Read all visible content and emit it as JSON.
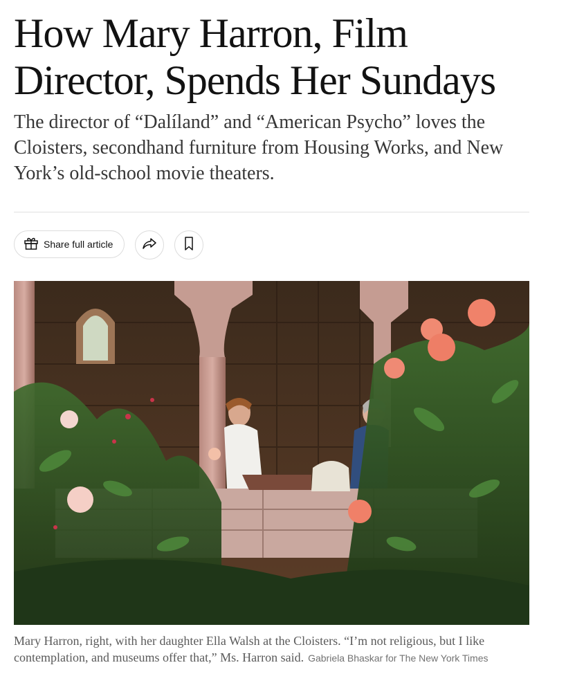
{
  "article": {
    "headline": "How Mary Harron, Film Director, Spends Her Sundays",
    "summary": "The director of “Dalíland” and “American Psycho” loves the Cloisters, secondhand furniture from Housing Works, and New York’s old-school movie theaters."
  },
  "share_bar": {
    "share_full_label": "Share full article",
    "icons": {
      "gift": "gift-icon",
      "share": "share-arrow-icon",
      "save": "bookmark-icon"
    }
  },
  "photo": {
    "caption": "Mary Harron, right, with her daughter Ella Walsh at the Cloisters. “I’m not religious, but I like contemplation, and museums offer that,” Ms. Harron said.",
    "credit": "Gabriela Bhaskar for The New York Times"
  },
  "colors": {
    "text": "#121212",
    "summary": "#363636",
    "caption": "#5a5a5a",
    "rule": "#dfdfdf"
  }
}
